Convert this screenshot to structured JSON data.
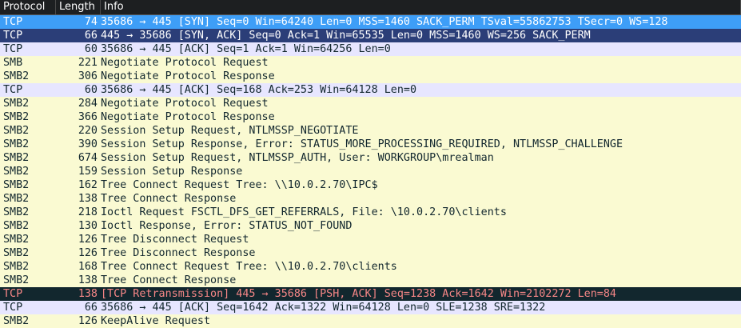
{
  "columns": {
    "protocol": "Protocol",
    "length": "Length",
    "info": "Info"
  },
  "rows": [
    {
      "protocol": "TCP",
      "length": "74",
      "info": "35686 → 445 [SYN] Seq=0 Win=64240 Len=0 MSS=1460 SACK_PERM TSval=55862753 TSecr=0 WS=128",
      "style": "sel1"
    },
    {
      "protocol": "TCP",
      "length": "66",
      "info": "445 → 35686 [SYN, ACK] Seq=0 Ack=1 Win=65535 Len=0 MSS=1460 WS=256 SACK_PERM",
      "style": "sel2"
    },
    {
      "protocol": "TCP",
      "length": "60",
      "info": "35686 → 445 [ACK] Seq=1 Ack=1 Win=64256 Len=0",
      "style": "tcp"
    },
    {
      "protocol": "SMB",
      "length": "221",
      "info": "Negotiate Protocol Request",
      "style": "smb"
    },
    {
      "protocol": "SMB2",
      "length": "306",
      "info": "Negotiate Protocol Response",
      "style": "smb"
    },
    {
      "protocol": "TCP",
      "length": "60",
      "info": "35686 → 445 [ACK] Seq=168 Ack=253 Win=64128 Len=0",
      "style": "tcp"
    },
    {
      "protocol": "SMB2",
      "length": "284",
      "info": "Negotiate Protocol Request",
      "style": "smb"
    },
    {
      "protocol": "SMB2",
      "length": "366",
      "info": "Negotiate Protocol Response",
      "style": "smb"
    },
    {
      "protocol": "SMB2",
      "length": "220",
      "info": "Session Setup Request, NTLMSSP_NEGOTIATE",
      "style": "smb"
    },
    {
      "protocol": "SMB2",
      "length": "390",
      "info": "Session Setup Response, Error: STATUS_MORE_PROCESSING_REQUIRED, NTLMSSP_CHALLENGE",
      "style": "smb"
    },
    {
      "protocol": "SMB2",
      "length": "674",
      "info": "Session Setup Request, NTLMSSP_AUTH, User: WORKGROUP\\mrealman",
      "style": "smb"
    },
    {
      "protocol": "SMB2",
      "length": "159",
      "info": "Session Setup Response",
      "style": "smb"
    },
    {
      "protocol": "SMB2",
      "length": "162",
      "info": "Tree Connect Request Tree: \\\\10.0.2.70\\IPC$",
      "style": "smb"
    },
    {
      "protocol": "SMB2",
      "length": "138",
      "info": "Tree Connect Response",
      "style": "smb"
    },
    {
      "protocol": "SMB2",
      "length": "218",
      "info": "Ioctl Request FSCTL_DFS_GET_REFERRALS, File: \\10.0.2.70\\clients",
      "style": "smb"
    },
    {
      "protocol": "SMB2",
      "length": "130",
      "info": "Ioctl Response, Error: STATUS_NOT_FOUND",
      "style": "smb"
    },
    {
      "protocol": "SMB2",
      "length": "126",
      "info": "Tree Disconnect Request",
      "style": "smb"
    },
    {
      "protocol": "SMB2",
      "length": "126",
      "info": "Tree Disconnect Response",
      "style": "smb"
    },
    {
      "protocol": "SMB2",
      "length": "168",
      "info": "Tree Connect Request Tree: \\\\10.0.2.70\\clients",
      "style": "smb"
    },
    {
      "protocol": "SMB2",
      "length": "138",
      "info": "Tree Connect Response",
      "style": "smb"
    },
    {
      "protocol": "TCP",
      "length": "138",
      "info": "[TCP Retransmission] 445 → 35686 [PSH, ACK] Seq=1238 Ack=1642 Win=2102272 Len=84",
      "style": "err"
    },
    {
      "protocol": "TCP",
      "length": "66",
      "info": "35686 → 445 [ACK] Seq=1642 Ack=1322 Win=64128 Len=0 SLE=1238 SRE=1322",
      "style": "tcp"
    },
    {
      "protocol": "SMB2",
      "length": "126",
      "info": "KeepAlive Request",
      "style": "smb"
    }
  ]
}
